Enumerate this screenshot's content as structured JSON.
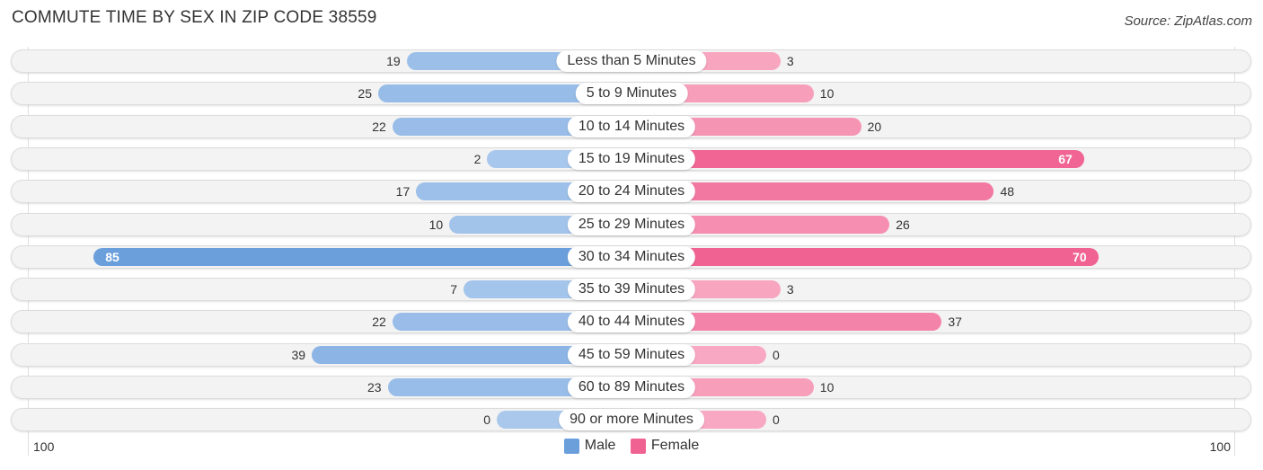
{
  "header": {
    "title": "COMMUTE TIME BY SEX IN ZIP CODE 38559",
    "source": "Source: ZipAtlas.com"
  },
  "colors": {
    "male": "#6a9fdc",
    "male_light": "#a9c8ec",
    "female": "#f06292",
    "female_light": "#f8a8c2"
  },
  "chart_data": {
    "type": "bar",
    "orientation": "horizontal-diverging",
    "title": "COMMUTE TIME BY SEX IN ZIP CODE 38559",
    "categories": [
      "Less than 5 Minutes",
      "5 to 9 Minutes",
      "10 to 14 Minutes",
      "15 to 19 Minutes",
      "20 to 24 Minutes",
      "25 to 29 Minutes",
      "30 to 34 Minutes",
      "35 to 39 Minutes",
      "40 to 44 Minutes",
      "45 to 59 Minutes",
      "60 to 89 Minutes",
      "90 or more Minutes"
    ],
    "series": [
      {
        "name": "Male",
        "values": [
          19,
          25,
          22,
          2,
          17,
          10,
          85,
          7,
          22,
          39,
          23,
          0
        ]
      },
      {
        "name": "Female",
        "values": [
          3,
          10,
          20,
          67,
          48,
          26,
          70,
          3,
          37,
          0,
          10,
          0
        ]
      }
    ],
    "axis": {
      "left_label": "100",
      "right_label": "100",
      "range": [
        0,
        100
      ]
    },
    "legend": {
      "position": "bottom-center",
      "entries": [
        "Male",
        "Female"
      ]
    }
  }
}
